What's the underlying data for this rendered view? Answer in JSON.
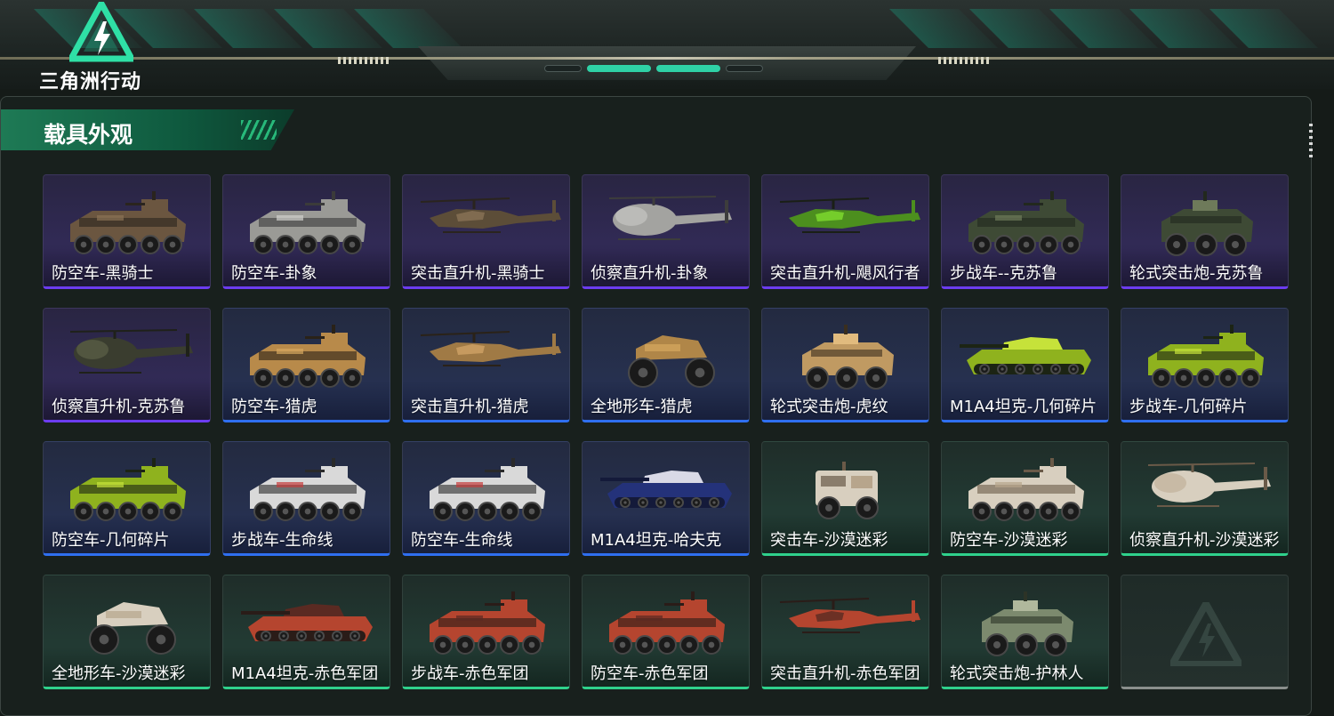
{
  "app": {
    "logo_text": "三角洲行动",
    "logo_icon": "triangle-bolt-icon"
  },
  "section": {
    "title": "载具外观"
  },
  "colors": {
    "purple": "#6c3cf0",
    "blue": "#2f6ff0",
    "green": "#2fd18c",
    "empty": "#8a8f8d",
    "title_bg": "#1e7a55"
  },
  "items": [
    {
      "name": "防空车-黑骑士",
      "rarity": "purple",
      "kind": "apc-turret",
      "camo": [
        "#6b5640",
        "#2a241e",
        "#8a7356"
      ]
    },
    {
      "name": "防空车-卦象",
      "rarity": "purple",
      "kind": "apc-turret",
      "camo": [
        "#9a9a96",
        "#3b3b3a",
        "#d0d0cc"
      ]
    },
    {
      "name": "突击直升机-黑骑士",
      "rarity": "purple",
      "kind": "attack-heli",
      "camo": [
        "#5c4d38",
        "#2a241e",
        "#8a7356"
      ]
    },
    {
      "name": "侦察直升机-卦象",
      "rarity": "purple",
      "kind": "scout-heli",
      "camo": [
        "#a3a3a0",
        "#3d3d3c",
        "#d4d4d0"
      ]
    },
    {
      "name": "突击直升机-飓风行者",
      "rarity": "purple",
      "kind": "attack-heli",
      "camo": [
        "#4c8f1e",
        "#1a1f16",
        "#7fdc2e"
      ]
    },
    {
      "name": "步战车--克苏鲁",
      "rarity": "purple",
      "kind": "apc-turret",
      "camo": [
        "#3e4a35",
        "#22281e",
        "#6e7a5a"
      ]
    },
    {
      "name": "轮式突击炮-克苏鲁",
      "rarity": "purple",
      "kind": "wheeled-gun",
      "camo": [
        "#3e4a35",
        "#22281e",
        "#6e7a5a"
      ]
    },
    {
      "name": "侦察直升机-克苏鲁",
      "rarity": "purple",
      "kind": "scout-heli",
      "camo": [
        "#3a3d2f",
        "#1f211a",
        "#6a6f52"
      ]
    },
    {
      "name": "防空车-猎虎",
      "rarity": "blue",
      "kind": "apc-turret",
      "camo": [
        "#b88a4a",
        "#2a2218",
        "#d7a85f"
      ]
    },
    {
      "name": "突击直升机-猎虎",
      "rarity": "blue",
      "kind": "attack-heli",
      "camo": [
        "#a07a45",
        "#2a2218",
        "#cfa265"
      ]
    },
    {
      "name": "全地形车-猎虎",
      "rarity": "blue",
      "kind": "atv",
      "camo": [
        "#b08648",
        "#2a2218",
        "#d7a85f"
      ]
    },
    {
      "name": "轮式突击炮-虎纹",
      "rarity": "blue",
      "kind": "wheeled-gun",
      "camo": [
        "#c09a62",
        "#3a2e1e",
        "#e1bb7e"
      ]
    },
    {
      "name": "M1A4坦克-几何碎片",
      "rarity": "blue",
      "kind": "tank",
      "camo": [
        "#8fb21e",
        "#1c2414",
        "#c6e23a"
      ]
    },
    {
      "name": "步战车-几何碎片",
      "rarity": "blue",
      "kind": "apc-turret",
      "camo": [
        "#8fb21e",
        "#1c2414",
        "#c6e23a"
      ]
    },
    {
      "name": "防空车-几何碎片",
      "rarity": "blue",
      "kind": "apc-turret",
      "camo": [
        "#8fb21e",
        "#1c2414",
        "#c6e23a"
      ]
    },
    {
      "name": "步战车-生命线",
      "rarity": "blue",
      "kind": "apc-turret",
      "camo": [
        "#d9d9d9",
        "#2a2a2a",
        "#c43a3a"
      ]
    },
    {
      "name": "防空车-生命线",
      "rarity": "blue",
      "kind": "apc-turret",
      "camo": [
        "#d9d9d9",
        "#2a2a2a",
        "#c43a3a"
      ]
    },
    {
      "name": "M1A4坦克-哈夫克",
      "rarity": "blue",
      "kind": "tank",
      "camo": [
        "#24327a",
        "#141a3a",
        "#d9d9e6"
      ]
    },
    {
      "name": "突击车-沙漠迷彩",
      "rarity": "green",
      "kind": "truck",
      "camo": [
        "#d8cfbf",
        "#6a5a48",
        "#b7a58c"
      ]
    },
    {
      "name": "防空车-沙漠迷彩",
      "rarity": "green",
      "kind": "apc-turret",
      "camo": [
        "#d8cfbf",
        "#6a5a48",
        "#b7a58c"
      ]
    },
    {
      "name": "侦察直升机-沙漠迷彩",
      "rarity": "green",
      "kind": "scout-heli",
      "camo": [
        "#d8cfbf",
        "#6a5a48",
        "#b7a58c"
      ]
    },
    {
      "name": "全地形车-沙漠迷彩",
      "rarity": "green",
      "kind": "atv",
      "camo": [
        "#d8cfbf",
        "#6a5a48",
        "#b7a58c"
      ]
    },
    {
      "name": "M1A4坦克-赤色军团",
      "rarity": "green",
      "kind": "tank",
      "camo": [
        "#b5452f",
        "#2a1c18",
        "#5a2a22"
      ]
    },
    {
      "name": "步战车-赤色军团",
      "rarity": "green",
      "kind": "apc-turret",
      "camo": [
        "#b5452f",
        "#2a1c18",
        "#5a2a22"
      ]
    },
    {
      "name": "防空车-赤色军团",
      "rarity": "green",
      "kind": "apc-turret",
      "camo": [
        "#b5452f",
        "#2a1c18",
        "#5a2a22"
      ]
    },
    {
      "name": "突击直升机-赤色军团",
      "rarity": "green",
      "kind": "attack-heli",
      "camo": [
        "#b5452f",
        "#2a1c18",
        "#5a2a22"
      ]
    },
    {
      "name": "轮式突击炮-护林人",
      "rarity": "green",
      "kind": "wheeled-gun",
      "camo": [
        "#7c8a6e",
        "#2c3326",
        "#b0b89c"
      ]
    },
    {
      "name": "",
      "rarity": "empty",
      "kind": "empty",
      "camo": []
    }
  ]
}
